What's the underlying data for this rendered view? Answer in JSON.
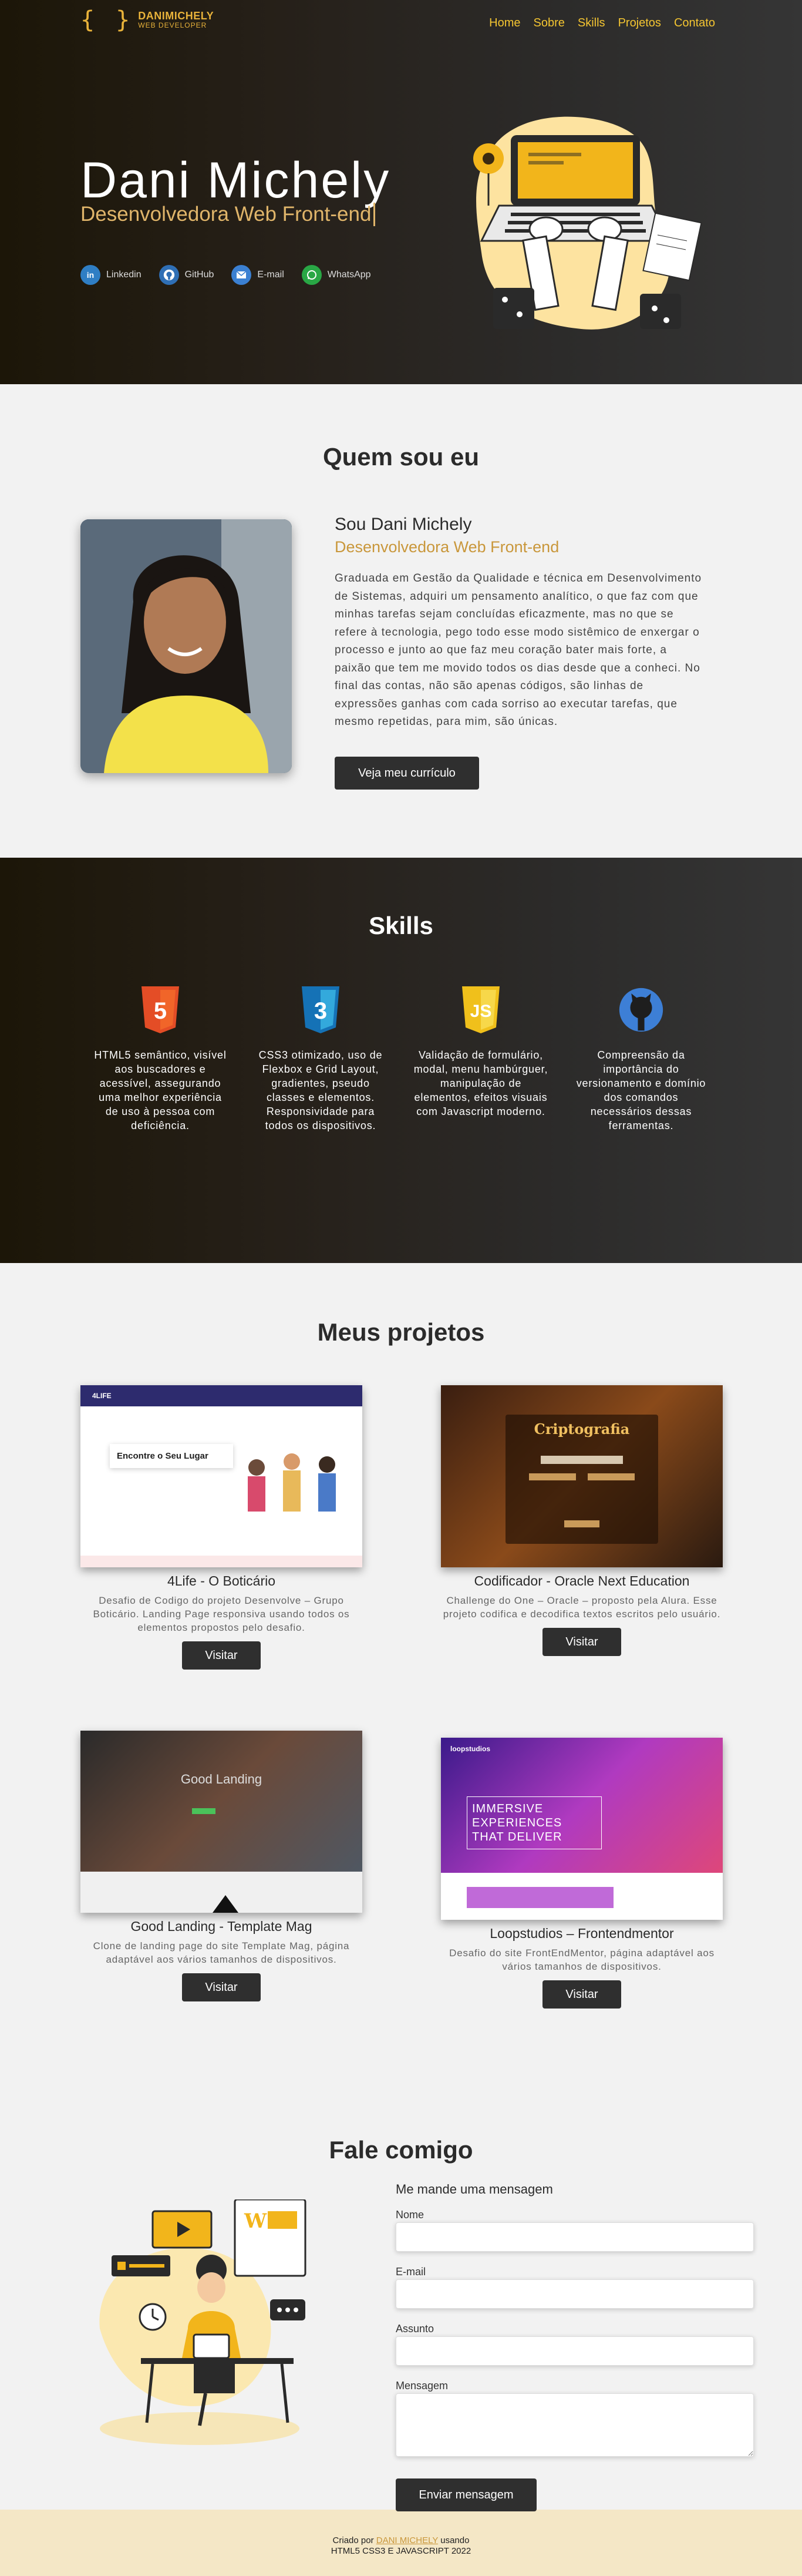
{
  "nav": {
    "logo_name": "DANIMICHELY",
    "logo_sub": "WEB DEVELOPER",
    "logo_braces": "{ }",
    "links": [
      "Home",
      "Sobre",
      "Skills",
      "Projetos",
      "Contato"
    ]
  },
  "hero": {
    "name": "Dani Michely",
    "role": "Desenvolvedora Web Front-end",
    "socials": [
      {
        "label": "Linkedin",
        "icon": "linkedin-icon",
        "color": "#2f7ec4"
      },
      {
        "label": "GitHub",
        "icon": "github-icon",
        "color": "#2f6fb5"
      },
      {
        "label": "E-mail",
        "icon": "email-icon",
        "color": "#3b80d2"
      },
      {
        "label": "WhatsApp",
        "icon": "whatsapp-icon",
        "color": "#29a745"
      }
    ]
  },
  "about": {
    "title": "Quem sou eu",
    "name": "Sou Dani Michely",
    "role": "Desenvolvedora Web Front-end",
    "text": "Graduada em Gestão da Qualidade e técnica em Desenvolvimento de Sistemas, adquiri um pensamento analítico, o que faz com que minhas tarefas sejam concluídas eficazmente, mas no que se refere à tecnologia, pego todo esse modo sistêmico de enxergar o processo e junto ao que faz meu coração bater mais forte, a paixão que tem me movido todos os dias desde que a conheci. No final das contas, não são apenas códigos, são linhas de expressões ganhas com cada sorriso ao executar tarefas, que mesmo repetidas, para mim, são únicas.",
    "button": "Veja meu currículo"
  },
  "skills": {
    "title": "Skills",
    "items": [
      {
        "icon": "html5-icon",
        "badge": "5",
        "color": "#e44d26",
        "text": "HTML5 semântico, visível aos buscadores e acessível, assegurando uma melhor experiência de uso à pessoa com deficiência."
      },
      {
        "icon": "css3-icon",
        "badge": "3",
        "color": "#2965f1",
        "text": "CSS3 otimizado, uso de Flexbox e Grid Layout, gradientes, pseudo classes e elementos. Responsividade para todos os dispositivos."
      },
      {
        "icon": "javascript-icon",
        "badge": "JS",
        "color": "#f7c51e",
        "text": "Validação de formulário, modal, menu hambúrguer, manipulação de elementos, efeitos visuais com Javascript moderno."
      },
      {
        "icon": "github-icon",
        "badge": "",
        "color": "#3d7fd6",
        "text": "Compreensão da importância do versionamento e domínio dos comandos necessários dessas ferramentas."
      }
    ]
  },
  "projects": {
    "title": "Meus projetos",
    "items": [
      {
        "title": "4Life - O Boticário",
        "desc": "Desafio de Codigo do projeto Desenvolve – Grupo Boticário. Landing Page responsiva usando todos os elementos propostos pelo desafio.",
        "button": "Visitar",
        "shot_heading": "Encontre o Seu Lugar",
        "shot_brand": "4LIFE"
      },
      {
        "title": "Codificador - Oracle Next Education",
        "desc": "Challenge do One – Oracle – proposto pela Alura. Esse projeto codifica e decodifica textos escritos pelo usuário.",
        "button": "Visitar",
        "shot_heading": "Criptografia"
      },
      {
        "title": "Good Landing - Template Mag",
        "desc": "Clone de landing page do site Template Mag, página adaptável aos vários tamanhos de dispositivos.",
        "button": "Visitar",
        "shot_heading": "Good Landing"
      },
      {
        "title": "Loopstudios – Frontendmentor",
        "desc": "Desafio do site FrontEndMentor, página adaptável aos vários tamanhos de dispositivos.",
        "button": "Visitar",
        "shot_heading": "IMMERSIVE EXPERIENCES THAT DELIVER",
        "shot_brand": "loopstudios"
      }
    ]
  },
  "contact": {
    "title": "Fale comigo",
    "form_title": "Me mande uma mensagem",
    "labels": {
      "name": "Nome",
      "email": "E-mail",
      "subject": "Assunto",
      "message": "Mensagem"
    },
    "button": "Enviar mensagem"
  },
  "footer": {
    "prefix": "Criado por",
    "author": "DANI MICHELY",
    "suffix": "usando",
    "line2": "HTML5 CSS3 E JAVASCRIPT 2022"
  }
}
